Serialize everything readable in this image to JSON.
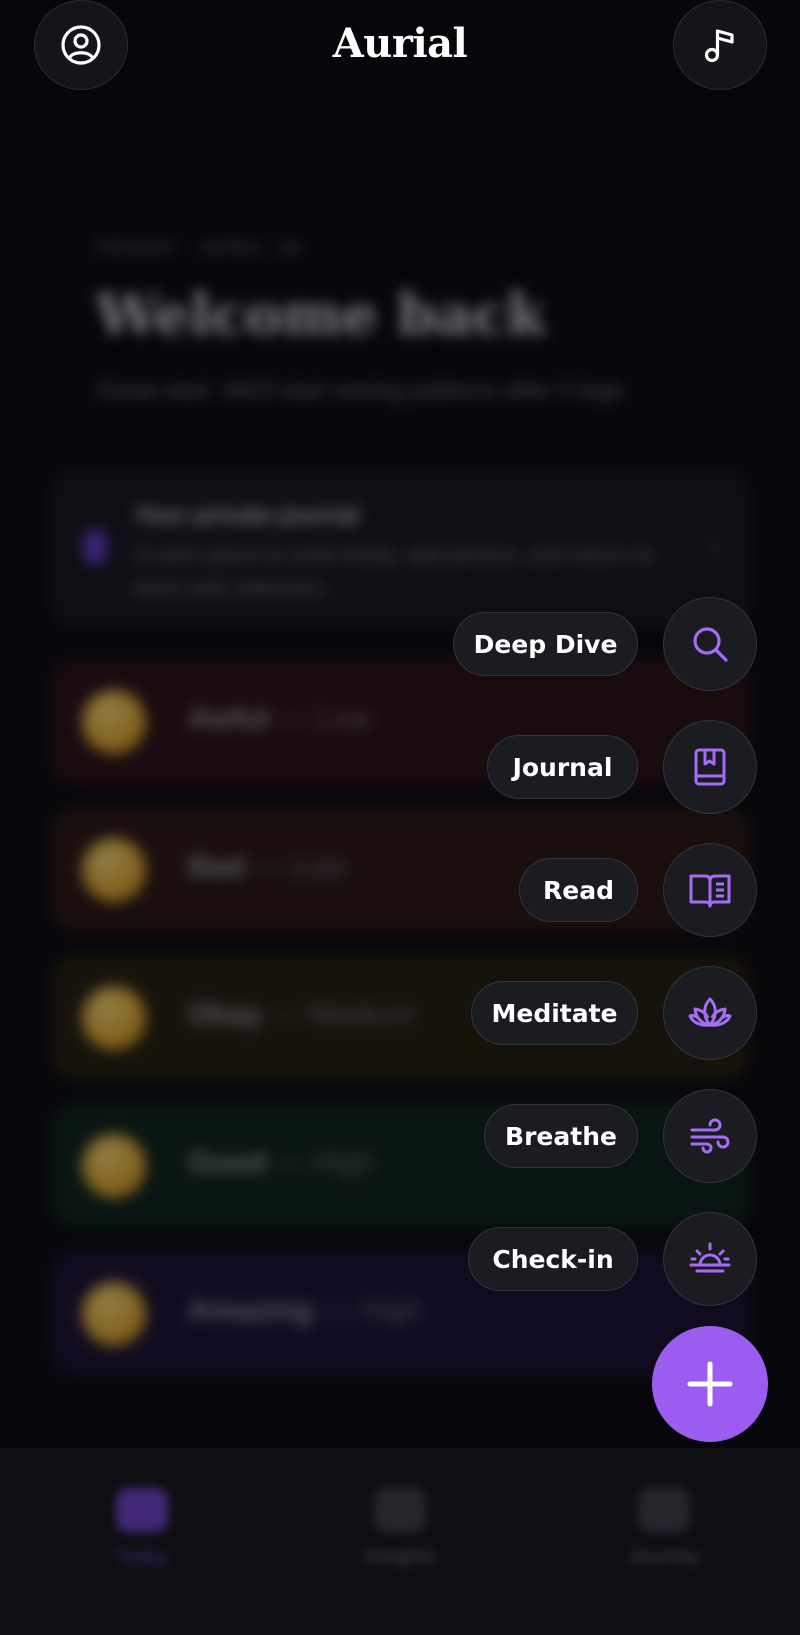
{
  "app": {
    "title": "Aurial"
  },
  "home": {
    "date": "FRIDAY · APRIL 18",
    "greeting": "Welcome back",
    "subtitle": "Great start. We'll start seeing patterns after 5 logs.",
    "journal_card": {
      "title": "Your private journal",
      "description": "A calm place to write freely, add photos, and return to them with reflection."
    },
    "moods": [
      {
        "name": "Awful",
        "level": "Low",
        "color": "#2a0f14"
      },
      {
        "name": "Bad",
        "level": "Low",
        "color": "#2a1610"
      },
      {
        "name": "Okay",
        "level": "Medium",
        "color": "#241d0c"
      },
      {
        "name": "Good",
        "level": "High",
        "color": "#0c2218"
      },
      {
        "name": "Amazing",
        "level": "High",
        "color": "#1a1030"
      }
    ],
    "separator": "—"
  },
  "speed_dial": {
    "items": [
      {
        "label": "Deep Dive",
        "icon": "search-icon"
      },
      {
        "label": "Journal",
        "icon": "bookmark-book-icon"
      },
      {
        "label": "Read",
        "icon": "open-book-icon"
      },
      {
        "label": "Meditate",
        "icon": "lotus-icon"
      },
      {
        "label": "Breathe",
        "icon": "wind-icon"
      },
      {
        "label": "Check-in",
        "icon": "sunrise-icon"
      }
    ],
    "fab_icon": "plus-icon"
  },
  "nav": {
    "items": [
      {
        "label": "Today",
        "icon": "home-icon"
      },
      {
        "label": "Insights",
        "icon": "chart-icon"
      },
      {
        "label": "Journey",
        "icon": "journal-icon"
      }
    ]
  },
  "colors": {
    "accent": "#9b5df0",
    "icon_accent": "#a66df2",
    "background": "#07070b"
  }
}
